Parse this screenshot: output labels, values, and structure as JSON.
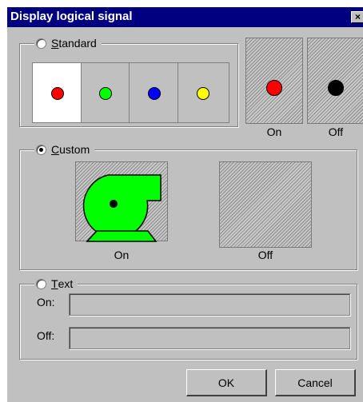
{
  "dialog": {
    "title": "Display logical signal",
    "close_glyph": "×"
  },
  "standard": {
    "label": "Standard",
    "mnemonic": "S",
    "rest": "tandard",
    "selected": false,
    "swatch_colors": [
      "#ff0000",
      "#00ff00",
      "#0000ff",
      "#ffff00"
    ],
    "on_caption": "On",
    "off_caption": "Off",
    "on_color": "#ff0000",
    "off_color": "#000000"
  },
  "custom": {
    "label": "Custom",
    "mnemonic": "C",
    "rest": "ustom",
    "selected": true,
    "on_caption": "On",
    "off_caption": "Off",
    "on_icon": "pump-icon",
    "pump_color": "#00ff00"
  },
  "text_group": {
    "label": "Text",
    "mnemonic": "T",
    "rest": "ext",
    "selected": false,
    "on_label": "On:",
    "off_label": "Off:",
    "on_value": "",
    "off_value": ""
  },
  "buttons": {
    "ok": "OK",
    "cancel": "Cancel"
  }
}
